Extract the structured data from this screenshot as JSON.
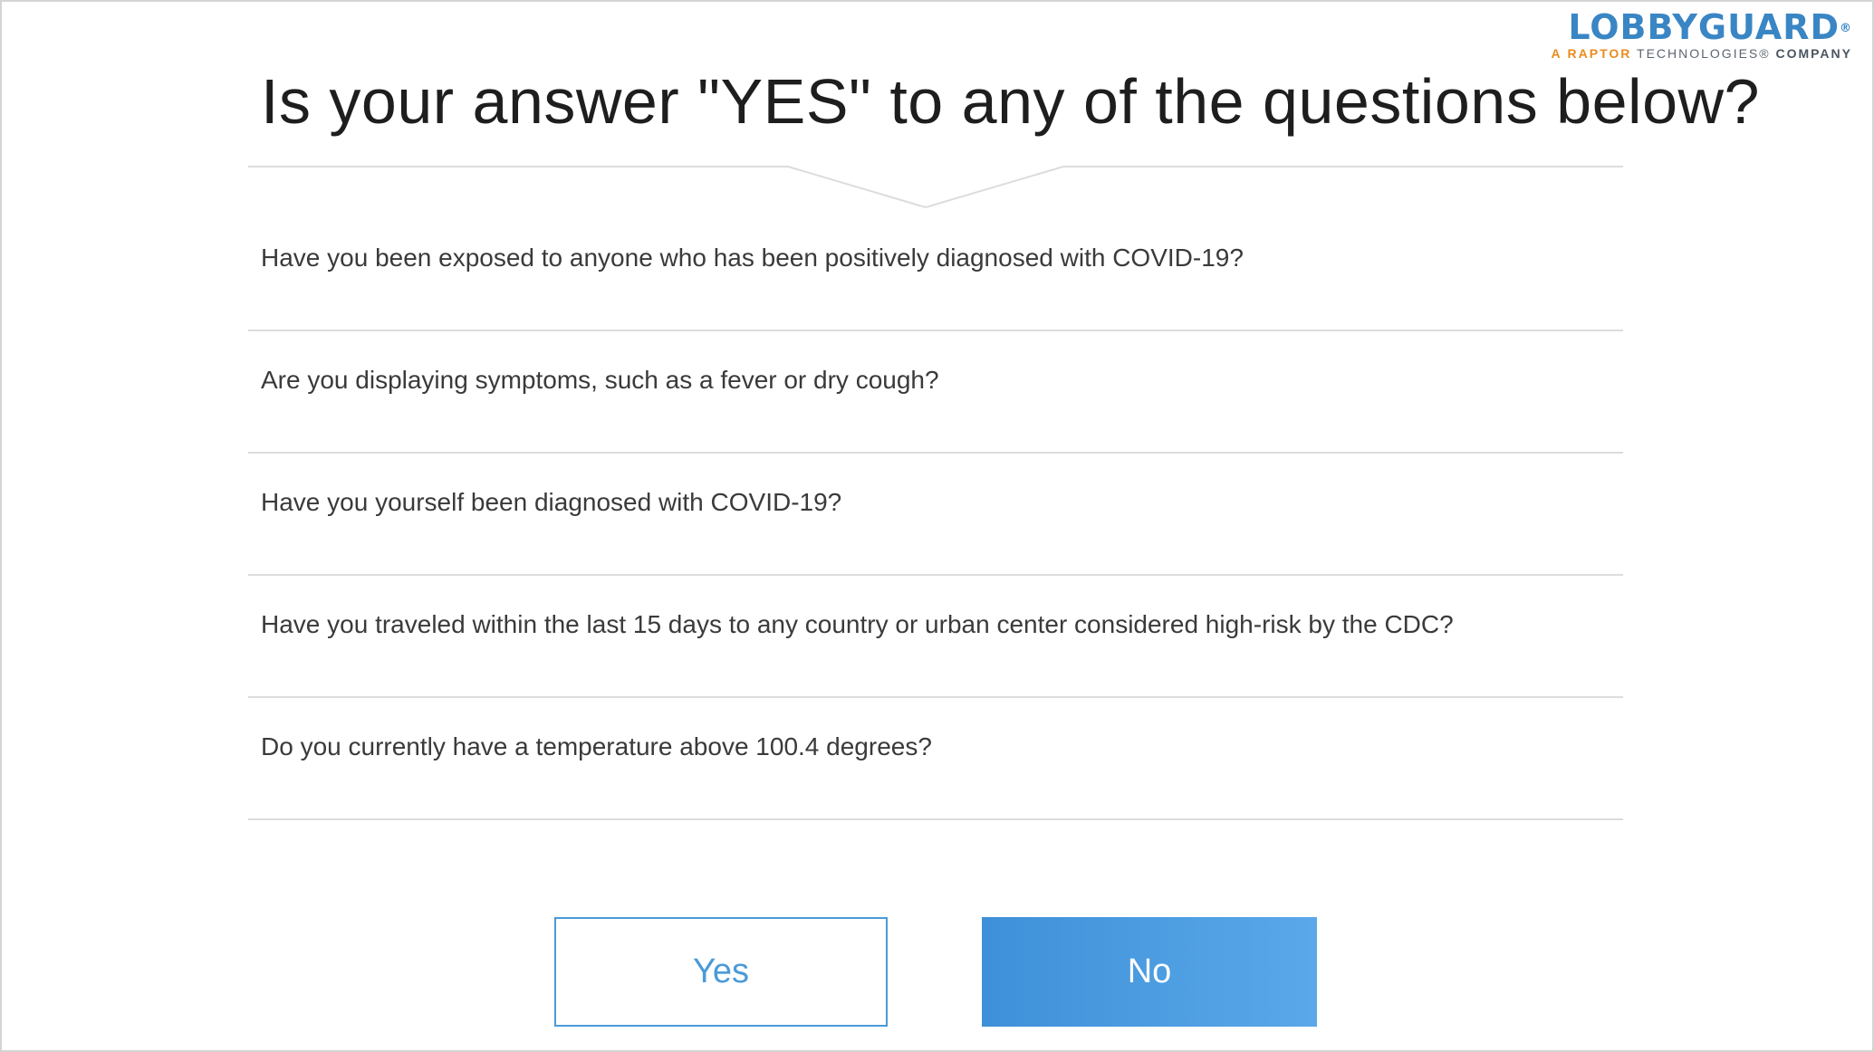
{
  "brand": {
    "wordmark": "LOBBYGUARD",
    "registered_mark": "®",
    "tagline_prefix": "A",
    "tagline_highlight": "RAPTOR",
    "tagline_middle": "TECHNOLOGIES®",
    "tagline_suffix": "COMPANY",
    "accent_color": "#3a86c4",
    "highlight_color": "#e98c1e"
  },
  "heading": "Is your answer \"YES\" to any of the questions below?",
  "questions": [
    "Have you been exposed to anyone who has been positively diagnosed with COVID-19?",
    "Are you displaying symptoms, such as a fever or dry cough?",
    "Have you yourself been diagnosed with COVID-19?",
    "Have you traveled within the last 15 days to any country or urban center considered high-risk by the CDC?",
    "Do you currently have a temperature above 100.4 degrees?"
  ],
  "buttons": {
    "yes_label": "Yes",
    "no_label": "No",
    "primary_color": "#4a9ad8"
  }
}
